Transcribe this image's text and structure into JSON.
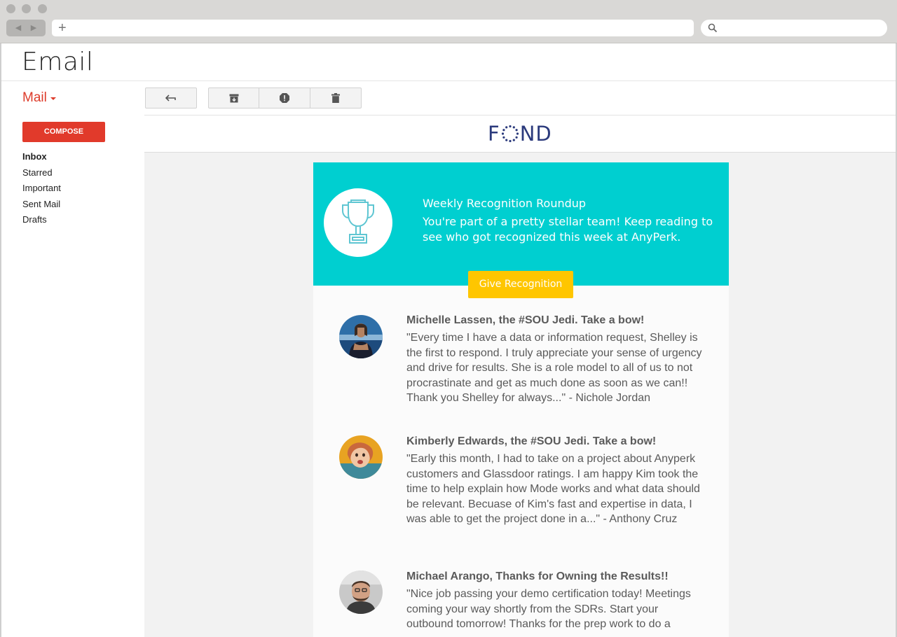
{
  "app": {
    "title": "Email"
  },
  "sidebar": {
    "mail_label": "Mail",
    "compose_label": "COMPOSE",
    "items": [
      {
        "label": "Inbox",
        "active": true
      },
      {
        "label": "Starred"
      },
      {
        "label": "Important"
      },
      {
        "label": "Sent Mail"
      },
      {
        "label": "Drafts"
      }
    ]
  },
  "toolbar": {
    "icons": [
      "reply-icon",
      "archive-icon",
      "report-spam-icon",
      "delete-icon"
    ]
  },
  "email": {
    "brand": {
      "prefix": "F",
      "suffix": "ND",
      "color": "#2b3a7c"
    },
    "hero": {
      "title": "Weekly Recognition Roundup",
      "text": "You're part of a pretty stellar team! Keep reading to see who got recognized this week at AnyPerk.",
      "button_label": "Give Recognition",
      "bg_color": "#00cfd0",
      "button_color": "#ffc600"
    },
    "entries": [
      {
        "title": "Michelle Lassen, the #SOU Jedi. Take a bow!",
        "body": "\"Every time I have a data or information request, Shelley is the first to respond. I truly appreciate your sense of urgency and drive for results. She is a role model to all of us to not procrastinate and get as much done as soon as we can!! Thank you Shelley for always...\" - Nichole Jordan"
      },
      {
        "title": "Kimberly Edwards, the #SOU Jedi. Take a bow!",
        "body": "\"Early this month, I had to take on a project about Anyperk customers and Glassdoor ratings. I am happy Kim took the time to help explain how Mode works and what data should be relevant. Becuase of Kim's fast and expertise in data, I was able to get the project done in a...\" - Anthony Cruz"
      },
      {
        "title": "Michael Arango, Thanks for Owning the Results!!",
        "body": "\"Nice job passing your demo certification today! Meetings coming your way shortly from the SDRs. Start your outbound tomorrow! Thanks for the prep work to do a"
      }
    ]
  },
  "colors": {
    "accent": "#dd3b2a",
    "compose": "#e13a2b"
  }
}
